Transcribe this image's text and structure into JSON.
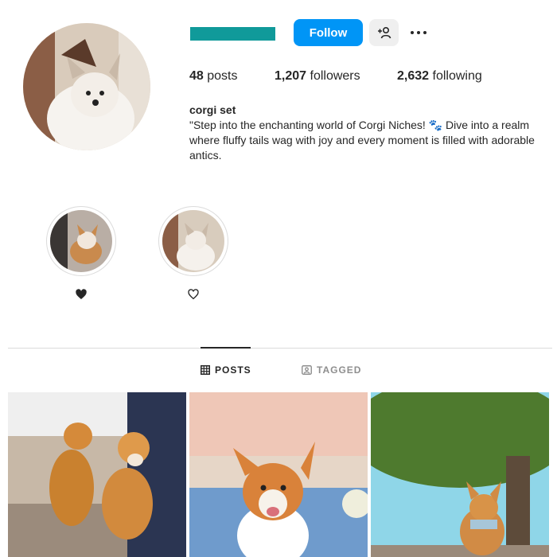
{
  "profile": {
    "follow_label": "Follow",
    "posts_count": "48",
    "posts_label": " posts",
    "followers_count": "1,207",
    "followers_label": " followers",
    "following_count": "2,632",
    "following_label": " following",
    "display_name": "corgi set",
    "bio": "\"Step into the enchanting world of Corgi Niches! 🐾 Dive into a realm where fluffy tails wag with joy and every moment is filled with adorable antics."
  },
  "highlights": [
    {
      "icon": "heart-filled-icon"
    },
    {
      "icon": "heart-outline-icon"
    }
  ],
  "tabs": [
    {
      "label": "POSTS",
      "icon": "grid-icon",
      "active": true
    },
    {
      "label": "TAGGED",
      "icon": "tag-icon",
      "active": false
    }
  ],
  "colors": {
    "accent": "#0095f6",
    "username_bar": "#109a9a"
  }
}
